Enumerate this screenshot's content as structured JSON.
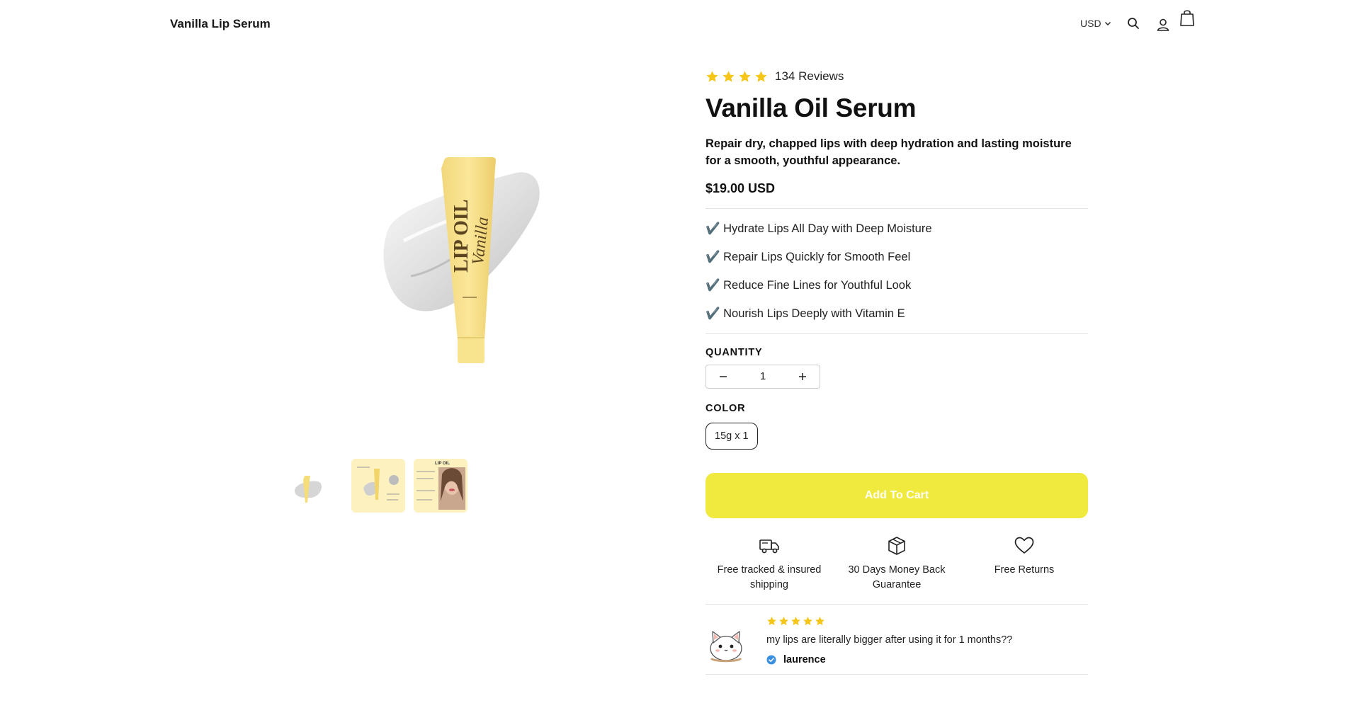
{
  "header": {
    "brand": "Vanilla Lip Serum",
    "currency": "USD",
    "icons": [
      "search-icon",
      "account-icon",
      "cart-icon"
    ]
  },
  "gallery": {
    "main_image": {
      "tube_text": "LIP OIL",
      "tube_script": "Vanilla"
    },
    "thumbnails": [
      {
        "name": "thumb-product"
      },
      {
        "name": "thumb-details"
      },
      {
        "name": "thumb-model",
        "caption": "LIP OIL"
      }
    ]
  },
  "product": {
    "rating_stars": 4,
    "reviews_label": "134 Reviews",
    "title": "Vanilla Oil Serum",
    "subtitle": "Repair dry, chapped lips with deep hydration and lasting moisture for a smooth, youthful appearance.",
    "price": "$19.00 USD",
    "benefits": [
      "✔️ Hydrate Lips All Day with Deep Moisture",
      "✔️ Repair Lips Quickly for Smooth Feel",
      "✔️ Reduce Fine Lines for Youthful Look",
      "✔️ Nourish Lips Deeply with Vitamin E"
    ],
    "quantity_label": "QUANTITY",
    "quantity_value": "1",
    "color_label": "COLOR",
    "color_option": "15g x 1",
    "add_to_cart": "Add To Cart"
  },
  "features": [
    {
      "icon": "truck-icon",
      "text": "Free tracked & insured shipping"
    },
    {
      "icon": "box-icon",
      "text": "30 Days Money Back Guarantee"
    },
    {
      "icon": "heart-icon",
      "text": "Free Returns"
    }
  ],
  "review": {
    "stars": 5,
    "text": "my lips are literally bigger after using it for 1 months??",
    "author": "laurence"
  },
  "colors": {
    "star": "#f5c518",
    "cart_button": "#f0ea3e",
    "tube": "#f7e08a",
    "verified": "#3b8fe0"
  }
}
